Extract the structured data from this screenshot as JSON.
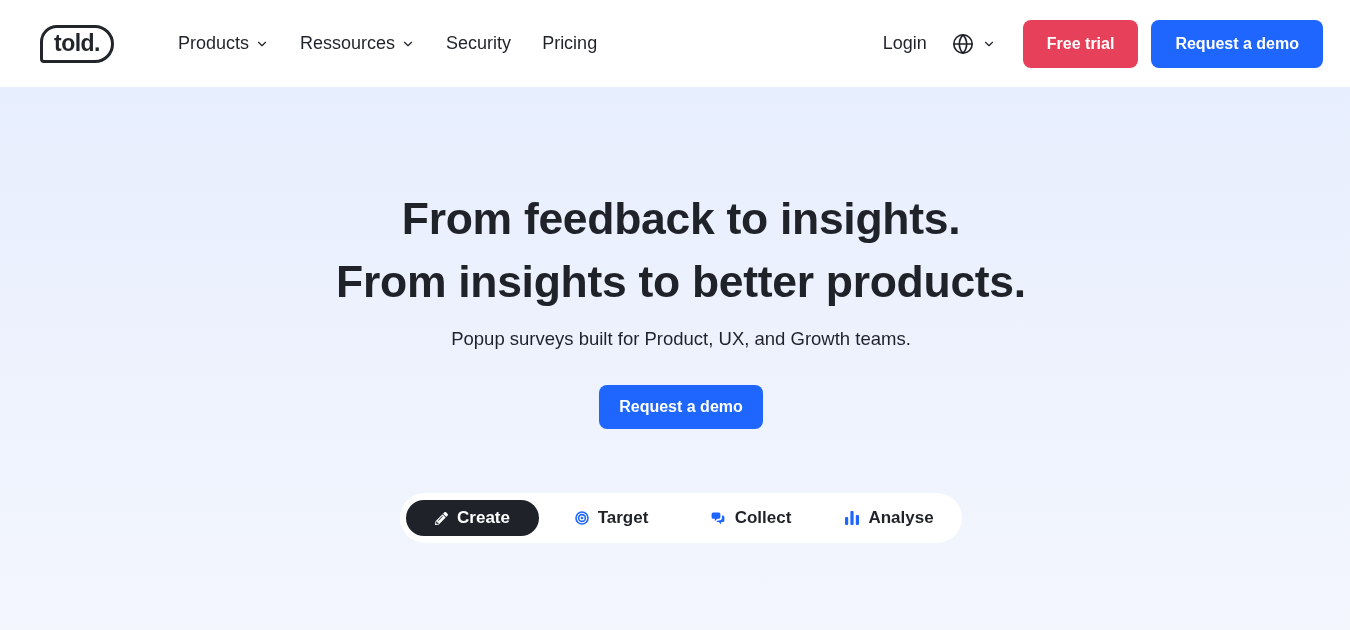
{
  "header": {
    "logo": "told.",
    "nav": [
      {
        "label": "Products",
        "dropdown": true
      },
      {
        "label": "Ressources",
        "dropdown": true
      },
      {
        "label": "Security",
        "dropdown": false
      },
      {
        "label": "Pricing",
        "dropdown": false
      }
    ],
    "login": "Login",
    "language": {
      "dropdown": true
    },
    "buttons": [
      {
        "label": "Free trial",
        "kind": "accent"
      },
      {
        "label": "Request a demo",
        "kind": "primary"
      }
    ]
  },
  "hero": {
    "title_lines": [
      "From feedback to insights.",
      "From insights to better products."
    ],
    "subtitle": "Popup surveys built for Product, UX, and Growth teams.",
    "cta": "Request a demo",
    "tabs": [
      {
        "label": "Create",
        "selected": true
      },
      {
        "label": "Target",
        "selected": false
      },
      {
        "label": "Collect",
        "selected": false
      },
      {
        "label": "Analyse",
        "selected": false
      }
    ]
  }
}
